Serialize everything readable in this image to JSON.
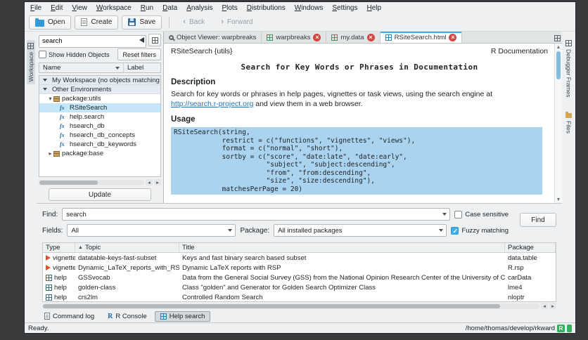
{
  "colors": {
    "accent": "#3daee9",
    "code_selection": "#aad3ef",
    "link": "#2475b4",
    "status_badge_green": "#35b05f",
    "vignette_icon": "#d9542b",
    "table_icon_green": "#27a05c",
    "help_icon_blue": "#2e6da4"
  },
  "menu": {
    "items": [
      "File",
      "Edit",
      "View",
      "Workspace",
      "Run",
      "Data",
      "Analysis",
      "Plots",
      "Distributions",
      "Windows",
      "Settings",
      "Help"
    ]
  },
  "toolbar": {
    "open": "Open",
    "create": "Create",
    "save": "Save",
    "back": "Back",
    "forward": "Forward"
  },
  "strips": {
    "workspace": "Workspace",
    "debugger_frames": "Debugger Frames",
    "files": "Files"
  },
  "workspace_panel": {
    "search_value": "search",
    "show_hidden_label": "Show Hidden Objects",
    "reset_filters_label": "Reset filters",
    "columns": {
      "name": "Name",
      "label": "Label"
    },
    "tree": [
      {
        "kind": "category",
        "label": "My Workspace (no objects matching filter)"
      },
      {
        "kind": "category",
        "label": "Other Environments"
      },
      {
        "kind": "item",
        "label": "package:utils",
        "icon": "package",
        "expander": "expanded",
        "indent": 1
      },
      {
        "kind": "item",
        "label": "RSiteSearch",
        "icon": "function",
        "indent": 2,
        "selected": true
      },
      {
        "kind": "item",
        "label": "help.search",
        "icon": "function",
        "indent": 2
      },
      {
        "kind": "item",
        "label": "hsearch_db",
        "icon": "function",
        "indent": 2
      },
      {
        "kind": "item",
        "label": "hsearch_db_concepts",
        "icon": "function",
        "indent": 2
      },
      {
        "kind": "item",
        "label": "hsearch_db_keywords",
        "icon": "function",
        "indent": 2
      },
      {
        "kind": "item",
        "label": "package:base",
        "icon": "package",
        "expander": "collapsed",
        "indent": 1
      }
    ],
    "update_label": "Update"
  },
  "tabs": [
    {
      "label": "Object Viewer: warpbreaks",
      "icon": "viewer",
      "close": false,
      "active": false
    },
    {
      "label": "warpbreaks",
      "icon": "table",
      "close": true,
      "active": false
    },
    {
      "label": "my.data",
      "icon": "table",
      "close": true,
      "active": false
    },
    {
      "label": "RSiteSearch.html",
      "icon": "help",
      "close": true,
      "active": true
    }
  ],
  "help": {
    "topic": "RSiteSearch {utils}",
    "doc_label": "R Documentation",
    "title": "Search for Key Words or Phrases in Documentation",
    "description_heading": "Description",
    "desc_before": "Search for key words or phrases in help pages, vignettes or task views, using the search engine at ",
    "desc_link": "http://search.r-project.org",
    "desc_after": " and view them in a web browser.",
    "usage_heading": "Usage",
    "code_lines": [
      "RSiteSearch(string,",
      "            restrict = c(\"functions\", \"vignettes\", \"views\"),",
      "            format = c(\"normal\", \"short\"),",
      "            sortby = c(\"score\", \"date:late\", \"date:early\",",
      "                       \"subject\", \"subject:descending\",",
      "                       \"from\", \"from:descending\",",
      "                       \"size\", \"size:descending\"),",
      "            matchesPerPage = 20)"
    ]
  },
  "find_panel": {
    "find_label": "Find:",
    "find_value": "search",
    "case_sensitive_label": "Case sensitive",
    "find_button_label": "Find",
    "fields_label": "Fields:",
    "fields_value": "All",
    "package_label": "Package:",
    "package_value": "All installed packages",
    "fuzzy_label": "Fuzzy matching"
  },
  "results": {
    "columns": [
      "Type",
      "Topic",
      "Title",
      "Package"
    ],
    "rows": [
      {
        "type": "vignette",
        "topic": "datatable-keys-fast-subset",
        "title": "Keys and fast binary search based subset",
        "package": "data.table"
      },
      {
        "type": "vignette",
        "topic": "Dynamic_LaTeX_reports_with_RSP",
        "title": "Dynamic LaTeX reports with RSP",
        "package": "R.rsp"
      },
      {
        "type": "help",
        "topic": "GSSvocab",
        "title": "Data from the General Social Survey (GSS) from the National Opinion Research Center of the University of Chicago.",
        "package": "carData"
      },
      {
        "type": "help",
        "topic": "golden-class",
        "title": "Class \"golden\" and Generator for Golden Search Optimizer Class",
        "package": "lme4"
      },
      {
        "type": "help",
        "topic": "crs2lm",
        "title": "Controlled Random Search",
        "package": "nloptr"
      }
    ]
  },
  "bottom_tabs": [
    {
      "label": "Command log",
      "icon": "log",
      "active": false
    },
    {
      "label": "R Console",
      "icon": "console",
      "active": false
    },
    {
      "label": "Help search",
      "icon": "help",
      "active": true
    }
  ],
  "status": {
    "ready": "Ready.",
    "path": "/home/thomas/develop/rkward",
    "r_badge": "R"
  }
}
